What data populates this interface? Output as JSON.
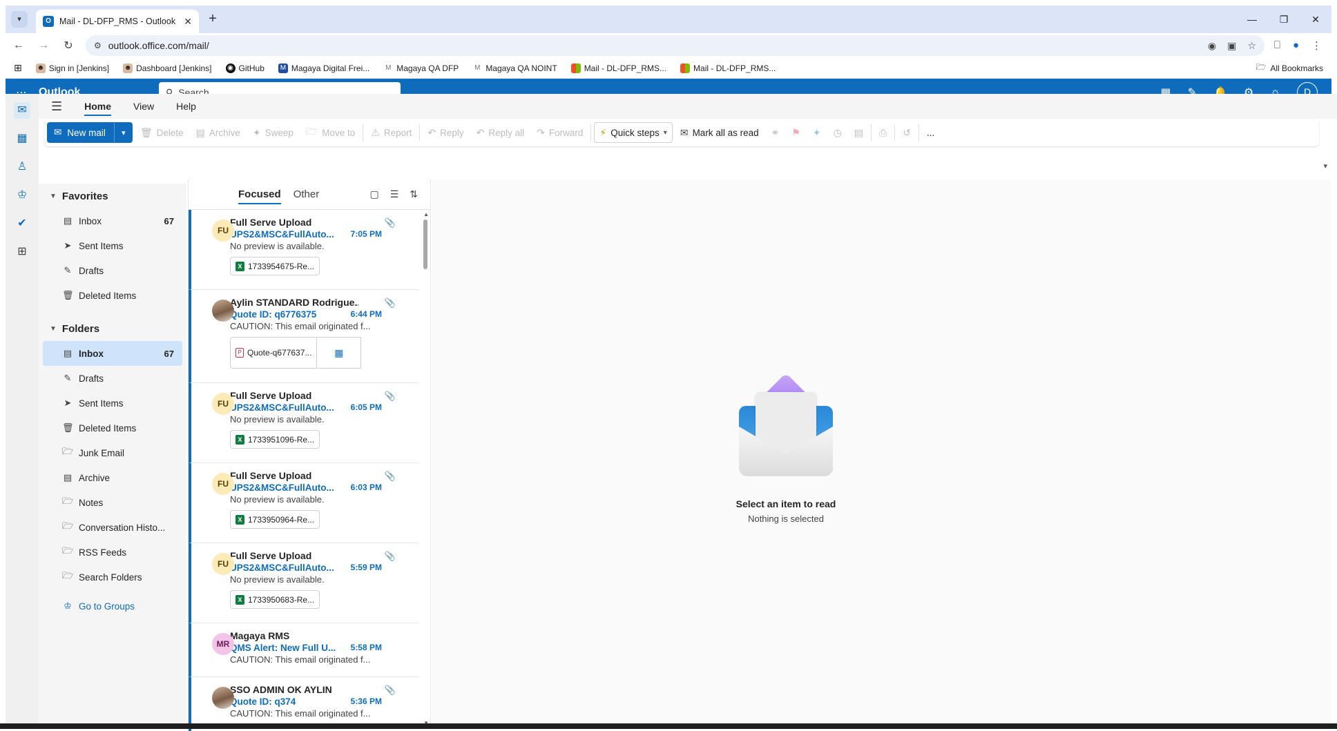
{
  "browser": {
    "tab_title": "Mail - DL-DFP_RMS - Outlook",
    "url": "outlook.office.com/mail/",
    "bookmarks": [
      {
        "label": "Sign in [Jenkins]"
      },
      {
        "label": "Dashboard [Jenkins]"
      },
      {
        "label": "GitHub"
      },
      {
        "label": "Magaya Digital Frei..."
      },
      {
        "label": "Magaya QA DFP"
      },
      {
        "label": "Magaya QA NOINT"
      },
      {
        "label": "Mail - DL-DFP_RMS..."
      },
      {
        "label": "Mail - DL-DFP_RMS..."
      }
    ],
    "all_bookmarks": "All Bookmarks"
  },
  "header": {
    "brand": "Outlook",
    "search_placeholder": "Search",
    "avatar_initial": "D"
  },
  "ribbon_tabs": [
    "Home",
    "View",
    "Help"
  ],
  "ribbon": {
    "new_mail": "New mail",
    "delete": "Delete",
    "archive": "Archive",
    "sweep": "Sweep",
    "move_to": "Move to",
    "report": "Report",
    "reply": "Reply",
    "reply_all": "Reply all",
    "forward": "Forward",
    "quick_steps": "Quick steps",
    "mark_all_read": "Mark all as read",
    "more": "..."
  },
  "folders": {
    "favorites_title": "Favorites",
    "favorites": [
      {
        "label": "Inbox",
        "count": "67",
        "icon": "inbox-icon"
      },
      {
        "label": "Sent Items",
        "count": "",
        "icon": "send-icon"
      },
      {
        "label": "Drafts",
        "count": "",
        "icon": "pencil-icon"
      },
      {
        "label": "Deleted Items",
        "count": "",
        "icon": "trash-icon"
      }
    ],
    "folders_title": "Folders",
    "folders": [
      {
        "label": "Inbox",
        "count": "67",
        "icon": "inbox-icon"
      },
      {
        "label": "Drafts",
        "count": "",
        "icon": "pencil-icon"
      },
      {
        "label": "Sent Items",
        "count": "",
        "icon": "send-icon"
      },
      {
        "label": "Deleted Items",
        "count": "",
        "icon": "trash-icon"
      },
      {
        "label": "Junk Email",
        "count": "",
        "icon": "junk-icon"
      },
      {
        "label": "Archive",
        "count": "",
        "icon": "archive-icon"
      },
      {
        "label": "Notes",
        "count": "",
        "icon": "folder-icon"
      },
      {
        "label": "Conversation Histo...",
        "count": "",
        "icon": "folder-icon"
      },
      {
        "label": "RSS Feeds",
        "count": "",
        "icon": "folder-icon"
      },
      {
        "label": "Search Folders",
        "count": "",
        "icon": "search-folder-icon"
      }
    ],
    "go_to_groups": "Go to Groups"
  },
  "message_list": {
    "tab_focused": "Focused",
    "tab_other": "Other",
    "messages": [
      {
        "initials": "FU",
        "sender": "Full Serve Upload",
        "subject": "UPS2&MSC&FullAuto...",
        "time": "7:05 PM",
        "preview": "No preview is available.",
        "attachment": "1733954675-Re...",
        "att_type": "xlsx"
      },
      {
        "initials": "",
        "sender": "Aylin STANDARD Rodrigue...",
        "subject": "Quote ID: q6776375",
        "time": "6:44 PM",
        "preview": "CAUTION: This email originated f...",
        "attachment": "Quote-q677637...",
        "att_type": "pdf"
      },
      {
        "initials": "FU",
        "sender": "Full Serve Upload",
        "subject": "UPS2&MSC&FullAuto...",
        "time": "6:05 PM",
        "preview": "No preview is available.",
        "attachment": "1733951096-Re...",
        "att_type": "xlsx"
      },
      {
        "initials": "FU",
        "sender": "Full Serve Upload",
        "subject": "UPS2&MSC&FullAuto...",
        "time": "6:03 PM",
        "preview": "No preview is available.",
        "attachment": "1733950964-Re...",
        "att_type": "xlsx"
      },
      {
        "initials": "FU",
        "sender": "Full Serve Upload",
        "subject": "UPS2&MSC&FullAuto...",
        "time": "5:59 PM",
        "preview": "No preview is available.",
        "attachment": "1733950683-Re...",
        "att_type": "xlsx"
      },
      {
        "initials": "MR",
        "sender": "Magaya RMS",
        "subject": "QMS Alert: New Full U...",
        "time": "5:58 PM",
        "preview": "CAUTION: This email originated f...",
        "attachment": "",
        "att_type": ""
      },
      {
        "initials": "",
        "sender": "SSO ADMIN OK AYLIN",
        "subject": "Quote ID: q374",
        "time": "5:36 PM",
        "preview": "CAUTION: This email originated f...",
        "attachment": "",
        "att_type": ""
      }
    ]
  },
  "reading_pane": {
    "title": "Select an item to read",
    "subtitle": "Nothing is selected"
  }
}
